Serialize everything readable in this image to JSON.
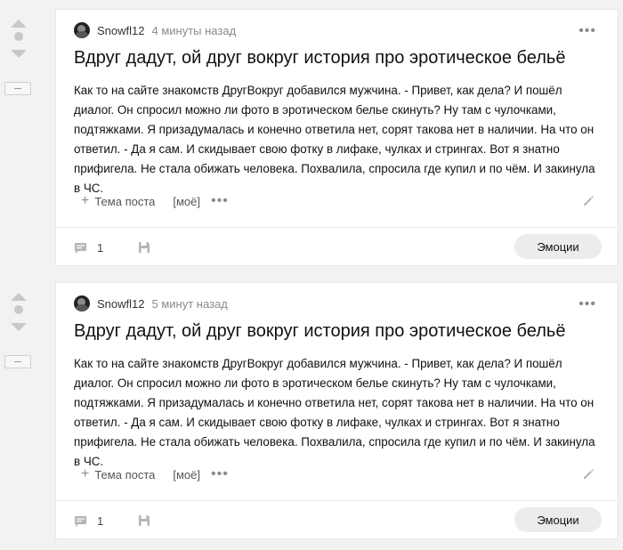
{
  "posts": [
    {
      "author": "Snowfl12",
      "time": "4 минуты назад",
      "title": "Вдруг дадут, ой друг вокруг история про эротическое бельё",
      "body": "Как то на сайте знакомств ДругВокруг добавился мужчина. - Привет, как дела? И пошёл диалог. Он спросил можно ли фото в эротическом белье скинуть? Ну там с чулочками, подтяжками. Я призадумалась и конечно ответила нет, сорят такова нет в наличии. На что он ответил. - Да я сам. И скидывает свою фотку в лифаке, чулках и стрингах. Вот я знатно прифигела. Не стала обижать человека. Похвалила, спросила где купил и по чём. И закинула в ЧС.",
      "tag_label": "Тема поста",
      "tag_mine": "[моё]",
      "comments": "1",
      "emotions_label": "Эмоции"
    },
    {
      "author": "Snowfl12",
      "time": "5 минут назад",
      "title": "Вдруг дадут, ой друг вокруг история про эротическое бельё",
      "body": "Как то на сайте знакомств ДругВокруг добавился мужчина. - Привет, как дела? И пошёл диалог. Он спросил можно ли фото в эротическом белье скинуть? Ну там с чулочками, подтяжками. Я призадумалась и конечно ответила нет, сорят такова нет в наличии. На что он ответил. - Да я сам. И скидывает свою фотку в лифаке, чулках и стрингах. Вот я знатно прифигела. Не стала обижать человека. Похвалила, спросила где купил и по чём. И закинула в ЧС.",
      "tag_label": "Тема поста",
      "tag_mine": "[моё]",
      "comments": "1",
      "emotions_label": "Эмоции"
    }
  ],
  "icons": {
    "more": "more-horizontal-icon",
    "upvote": "arrow-up-icon",
    "downvote": "arrow-down-icon",
    "comment": "comment-icon",
    "save": "save-icon",
    "edit": "pencil-icon",
    "add": "plus-icon"
  },
  "colors": {
    "page_background": "#f2f2f2",
    "card_background": "#ffffff",
    "muted_text": "#8a8a8a",
    "button_background": "#ececec"
  }
}
